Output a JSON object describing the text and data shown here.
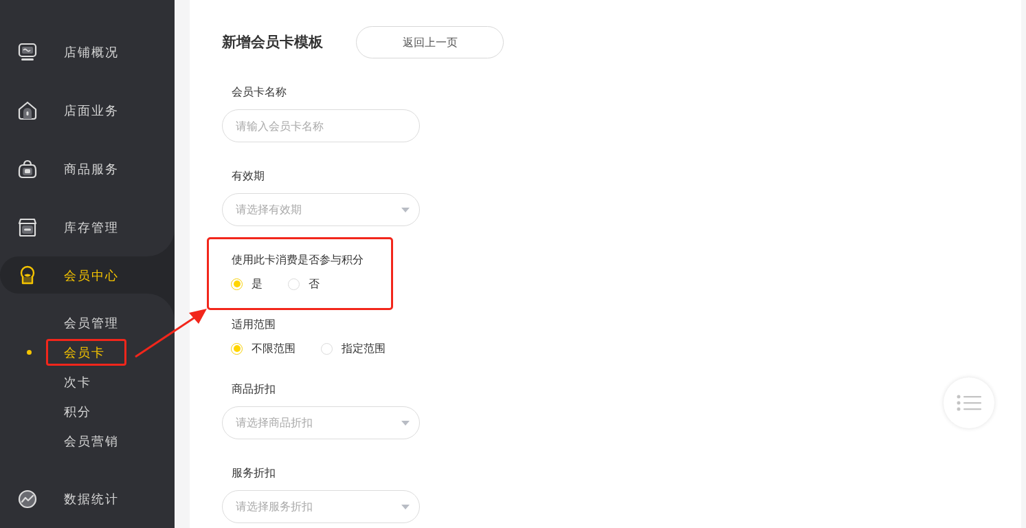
{
  "sidebar": {
    "items": [
      {
        "label": "店铺概况",
        "selected": false
      },
      {
        "label": "店面业务",
        "selected": false
      },
      {
        "label": "商品服务",
        "selected": false
      },
      {
        "label": "库存管理",
        "selected": false
      },
      {
        "label": "会员中心",
        "selected": true,
        "expanded": true,
        "children": [
          {
            "label": "会员管理",
            "selected": false
          },
          {
            "label": "会员卡",
            "selected": true
          },
          {
            "label": "次卡",
            "selected": false
          },
          {
            "label": "积分",
            "selected": false
          },
          {
            "label": "会员营销",
            "selected": false
          }
        ]
      },
      {
        "label": "数据统计",
        "selected": false
      }
    ]
  },
  "page": {
    "title": "新增会员卡模板",
    "back_button": "返回上一页"
  },
  "form": {
    "fields": [
      {
        "kind": "text",
        "label": "会员卡名称",
        "placeholder": "请输入会员卡名称"
      },
      {
        "kind": "select",
        "label": "有效期",
        "placeholder": "请选择有效期"
      },
      {
        "kind": "radio",
        "label": "使用此卡消费是否参与积分",
        "options": [
          {
            "label": "是",
            "selected": true
          },
          {
            "label": "否",
            "selected": false
          }
        ]
      },
      {
        "kind": "radio",
        "label": "适用范围",
        "options": [
          {
            "label": "不限范围",
            "selected": true
          },
          {
            "label": "指定范围",
            "selected": false
          }
        ]
      },
      {
        "kind": "select",
        "label": "商品折扣",
        "placeholder": "请选择商品折扣"
      },
      {
        "kind": "select",
        "label": "服务折扣",
        "placeholder": "请选择服务折扣"
      }
    ]
  }
}
